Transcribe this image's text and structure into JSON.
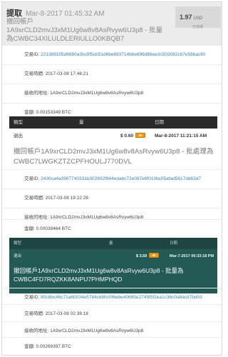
{
  "header": {
    "title": "提取",
    "date": "Mar-8-2017 01:45:32 AM",
    "address_line": "撤回帳戶1A9xrCLD2mvJ3xM1Ug6w8v8AsRvyw6U3p8 - 批量為CWBC34XILULDLERIULLO0KBQB7",
    "amount": "1.97",
    "unit": "USD",
    "status": "已完成"
  },
  "tx1": {
    "id_label": "交易ID:",
    "id_value": "221389105d6680a3bc8f5cb51d6be693714bbe696d88ee3c503082cb7e56bac60",
    "time_label": "交易時間:",
    "time_value": "2017-03-08 17:46:21",
    "recv_label": "接收的地址:",
    "recv_value": "1A9xrCLD2mvJ3xM1Ug6w8v8AsRvyw6U3p8",
    "amount_label": "金額:",
    "amount_value": "0.00153349 BTC"
  },
  "table1": {
    "col_type": "類型",
    "col_amount": "量",
    "col_date": "日期",
    "row_type": "退出",
    "row_amount": "$ 0.60",
    "row_date": "Mar-8-2017 11:21:15 AM"
  },
  "memo1": "撤回帳戶1A9xrCLD2mvJ3xM1Ug6w8v8AsRvyw6U3p8 - 批處理為CWBC7LWGKZTZCPFHOULJ770DVL",
  "tx2": {
    "id_label": "交易ID:",
    "id_value": "2430ca4a3967740331b302602f844edabc72e087e6f010bc05afad5617dd63d7",
    "time_label": "交易時間:",
    "time_value": "2017-03-08 19:22:28",
    "recv_label": "接收的地址:",
    "recv_value": "1A9xrCLD2mvJ3xM1Ug6w8v8AsRvyw6U3p8",
    "amount_label": "金額:",
    "amount_value": "0.00039464 BTC"
  },
  "table2": {
    "col_type": "類型",
    "col_amount": "量",
    "col_date": "日期",
    "row_type": "退出",
    "row_amount": "$ 3.50",
    "row_date": "Mar-7-2017 06:33:18 PM"
  },
  "memo2": "撤回帳戶1A9xrCLD2mvJ3xM1Ug6w8v8AsRvyw6U3p8 - 批量為CWBC4FD7RQZKK8ANPU7PHMPHQD",
  "tx3": {
    "id_label": "交易ID:",
    "id_value": "80c8bc46c71a60034e5784cb90c0f6ebe40685e2745f5f2ea1c36c0a8acd7bd03",
    "time_label": "交易時間:",
    "time_value": "2017-03-08 02:36:16",
    "recv_label": "接收的地址:",
    "recv_value": "1A9xrCLD2mvJ3xM1Ug6w8v8AsRvyw6U3p8",
    "amount_label": "金額:",
    "amount_value": "0.00269397 BTC"
  }
}
